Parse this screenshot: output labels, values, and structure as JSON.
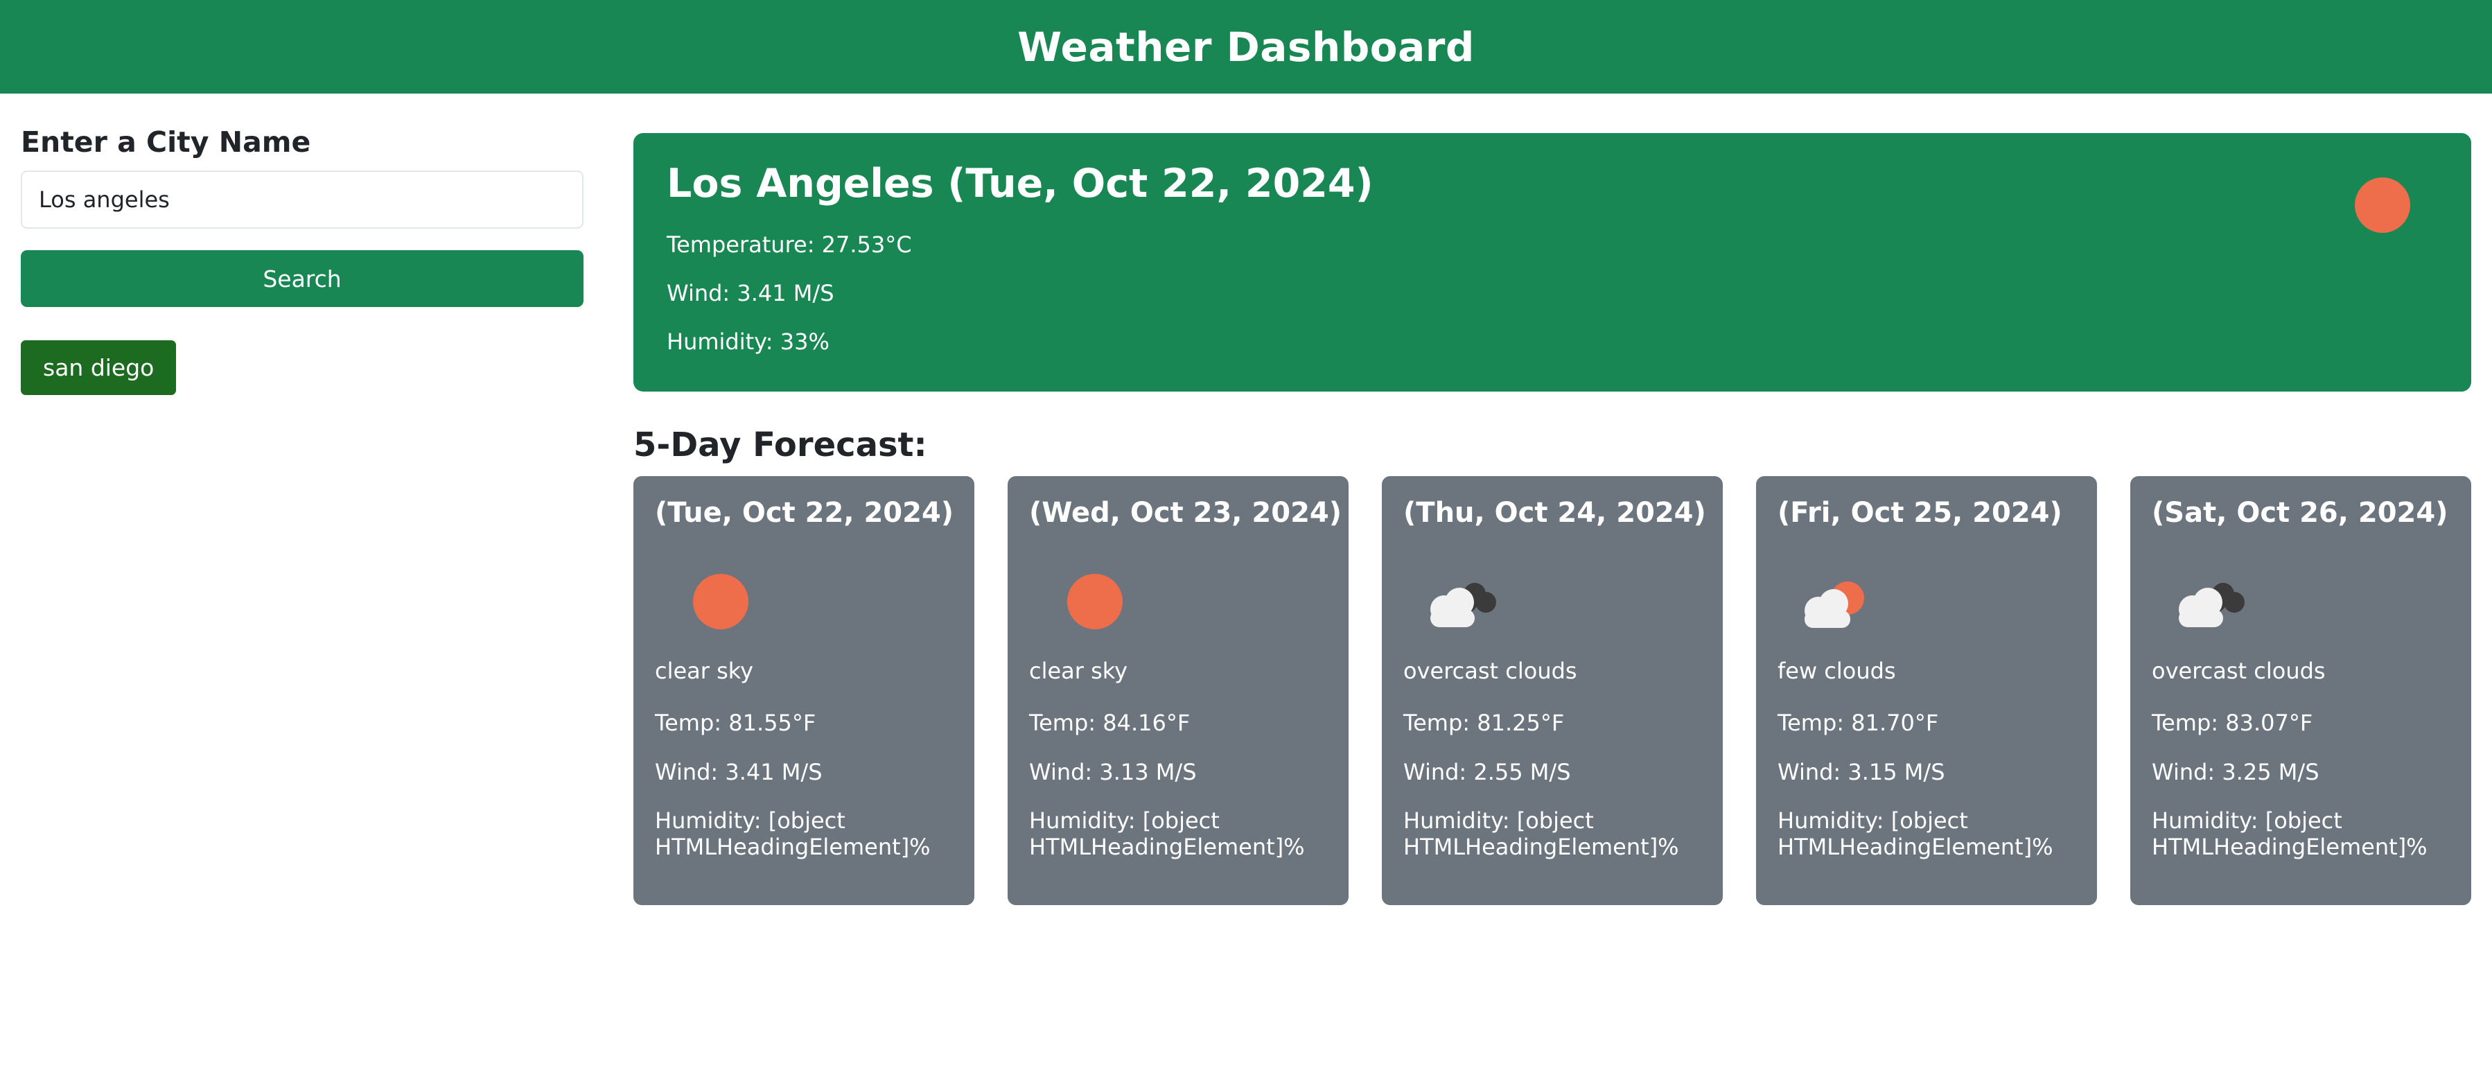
{
  "header": {
    "title": "Weather Dashboard"
  },
  "sidebar": {
    "label": "Enter a City Name",
    "input_value": "Los angeles",
    "search_label": "Search",
    "history": [
      "san diego"
    ]
  },
  "current": {
    "title": "Los Angeles (Tue, Oct 22, 2024)",
    "temperature": "Temperature: 27.53°C",
    "wind": "Wind: 3.41 M/S",
    "humidity": "Humidity: 33%",
    "icon": "sun-icon"
  },
  "forecast": {
    "heading": "5-Day Forecast:",
    "days": [
      {
        "date": "(Tue, Oct 22, 2024)",
        "icon": "sun-icon",
        "desc": "clear sky",
        "temp": "Temp: 81.55°F",
        "wind": "Wind: 3.41 M/S",
        "humidity": "Humidity: [object HTMLHeadingElement]%"
      },
      {
        "date": "(Wed, Oct 23, 2024)",
        "icon": "sun-icon",
        "desc": "clear sky",
        "temp": "Temp: 84.16°F",
        "wind": "Wind: 3.13 M/S",
        "humidity": "Humidity: [object HTMLHeadingElement]%"
      },
      {
        "date": "(Thu, Oct 24, 2024)",
        "icon": "overcast-clouds-icon",
        "desc": "overcast clouds",
        "temp": "Temp: 81.25°F",
        "wind": "Wind: 2.55 M/S",
        "humidity": "Humidity: [object HTMLHeadingElement]%"
      },
      {
        "date": "(Fri, Oct 25, 2024)",
        "icon": "few-clouds-icon",
        "desc": "few clouds",
        "temp": "Temp: 81.70°F",
        "wind": "Wind: 3.15 M/S",
        "humidity": "Humidity: [object HTMLHeadingElement]%"
      },
      {
        "date": "(Sat, Oct 26, 2024)",
        "icon": "overcast-clouds-icon",
        "desc": "overcast clouds",
        "temp": "Temp: 83.07°F",
        "wind": "Wind: 3.25 M/S",
        "humidity": "Humidity: [object HTMLHeadingElement]%"
      }
    ]
  },
  "colors": {
    "primary": "#198754",
    "history_button": "#1c6b21",
    "card": "#6c757d",
    "sun": "#ee6e4c"
  }
}
